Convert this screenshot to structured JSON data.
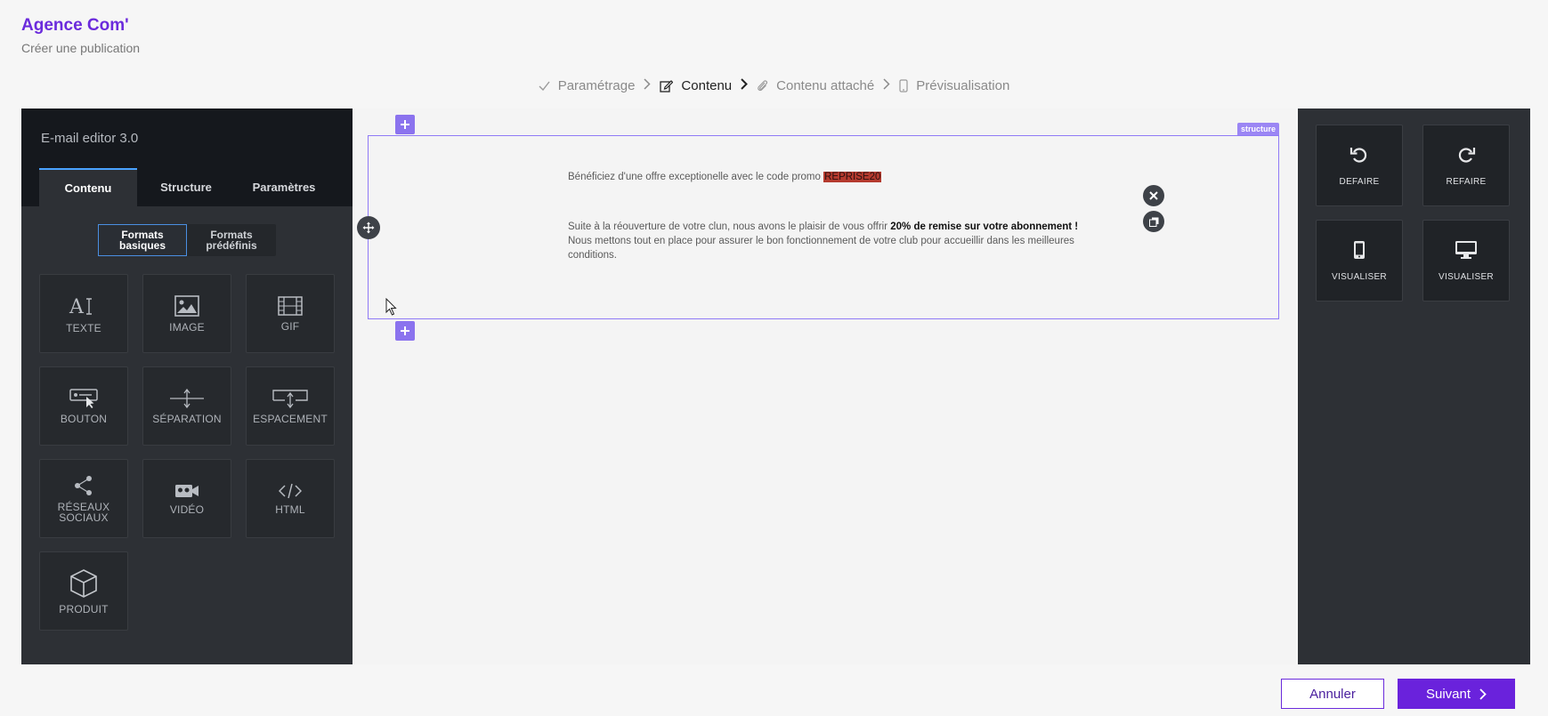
{
  "app": {
    "title": "Agence Com'",
    "subtitle": "Créer une publication"
  },
  "stepper": [
    {
      "label": "Paramétrage",
      "icon": "check-icon",
      "state": "done"
    },
    {
      "label": "Contenu",
      "icon": "edit-icon",
      "state": "active"
    },
    {
      "label": "Contenu attaché",
      "icon": "paperclip-icon",
      "state": "todo"
    },
    {
      "label": "Prévisualisation",
      "icon": "smartphone-icon",
      "state": "todo"
    }
  ],
  "left_panel": {
    "title": "E-mail editor 3.0",
    "tabs": [
      "Contenu",
      "Structure",
      "Paramètres"
    ],
    "active_tab": "Contenu",
    "format_toggle": [
      "Formats basiques",
      "Formats prédéfinis"
    ],
    "active_format": "Formats basiques",
    "blocks": [
      {
        "label": "TEXTE",
        "icon": "text-icon"
      },
      {
        "label": "IMAGE",
        "icon": "image-icon"
      },
      {
        "label": "GIF",
        "icon": "gif-film-icon"
      },
      {
        "label": "BOUTON",
        "icon": "button-icon"
      },
      {
        "label": "SÉPARATION",
        "icon": "separator-icon"
      },
      {
        "label": "ESPACEMENT",
        "icon": "spacing-icon"
      },
      {
        "label": "RÉSEAUX SOCIAUX",
        "icon": "share-icon"
      },
      {
        "label": "VIDÉO",
        "icon": "video-icon"
      },
      {
        "label": "HTML",
        "icon": "code-icon"
      },
      {
        "label": "PRODUIT",
        "icon": "box-icon"
      }
    ]
  },
  "canvas": {
    "structure_badge": "structure",
    "promo_text": "Bénéficiez d'une offre exceptionelle avec le code promo ",
    "promo_code": "REPRISE20",
    "para_normal": "Suite à la réouverture de votre clun, nous avons le plaisir de vous offrir ",
    "para_bold": "20% de remise sur votre abonnement !",
    "para_end": "Nous mettons tout en place pour assurer le bon fonctionnement de votre club pour accueillir dans les meilleures conditions."
  },
  "right_panel": {
    "actions": [
      {
        "label": "DEFAIRE",
        "icon": "undo-icon"
      },
      {
        "label": "REFAIRE",
        "icon": "redo-icon"
      },
      {
        "label": "VISUALISER",
        "icon": "mobile-icon"
      },
      {
        "label": "VISUALISER",
        "icon": "desktop-icon"
      }
    ]
  },
  "footer": {
    "cancel_label": "Annuler",
    "next_label": "Suivant"
  },
  "colors": {
    "accent": "#6a22dc",
    "frame": "#8f7af6",
    "promo_highlight": "#b43a2e"
  }
}
